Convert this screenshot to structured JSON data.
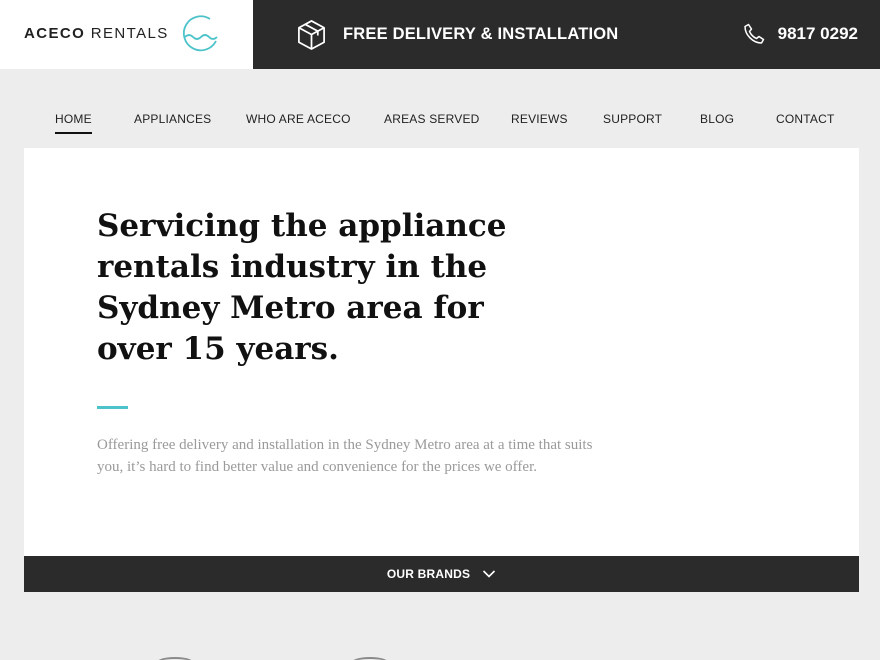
{
  "header": {
    "logo_bold": "ACECO",
    "logo_light": "RENTALS",
    "logo_icon": "wave-circle-icon",
    "delivery_icon": "box-icon",
    "delivery_label": "FREE DELIVERY & INSTALLATION",
    "phone_icon": "phone-icon",
    "phone_number": "9817 0292"
  },
  "nav": {
    "items": [
      {
        "label": "HOME",
        "active": true
      },
      {
        "label": "APPLIANCES"
      },
      {
        "label": "WHO ARE ACECO"
      },
      {
        "label": "AREAS SERVED"
      },
      {
        "label": "REVIEWS"
      },
      {
        "label": "SUPPORT"
      },
      {
        "label": "BLOG"
      },
      {
        "label": "CONTACT"
      }
    ]
  },
  "hero": {
    "title": "Servicing the appliance rentals industry in the Sydney Metro area for over 15 years.",
    "body": "Offering free delivery and installation in the Sydney Metro area at a time that suits you, it’s hard to find better value and convenience for the prices we offer."
  },
  "brands": {
    "label": "OUR BRANDS",
    "icon": "chevron-down-icon"
  },
  "colors": {
    "accent": "#4cc3c9",
    "dark_bar": "#2b2b2b",
    "page_bg": "#ededed"
  }
}
